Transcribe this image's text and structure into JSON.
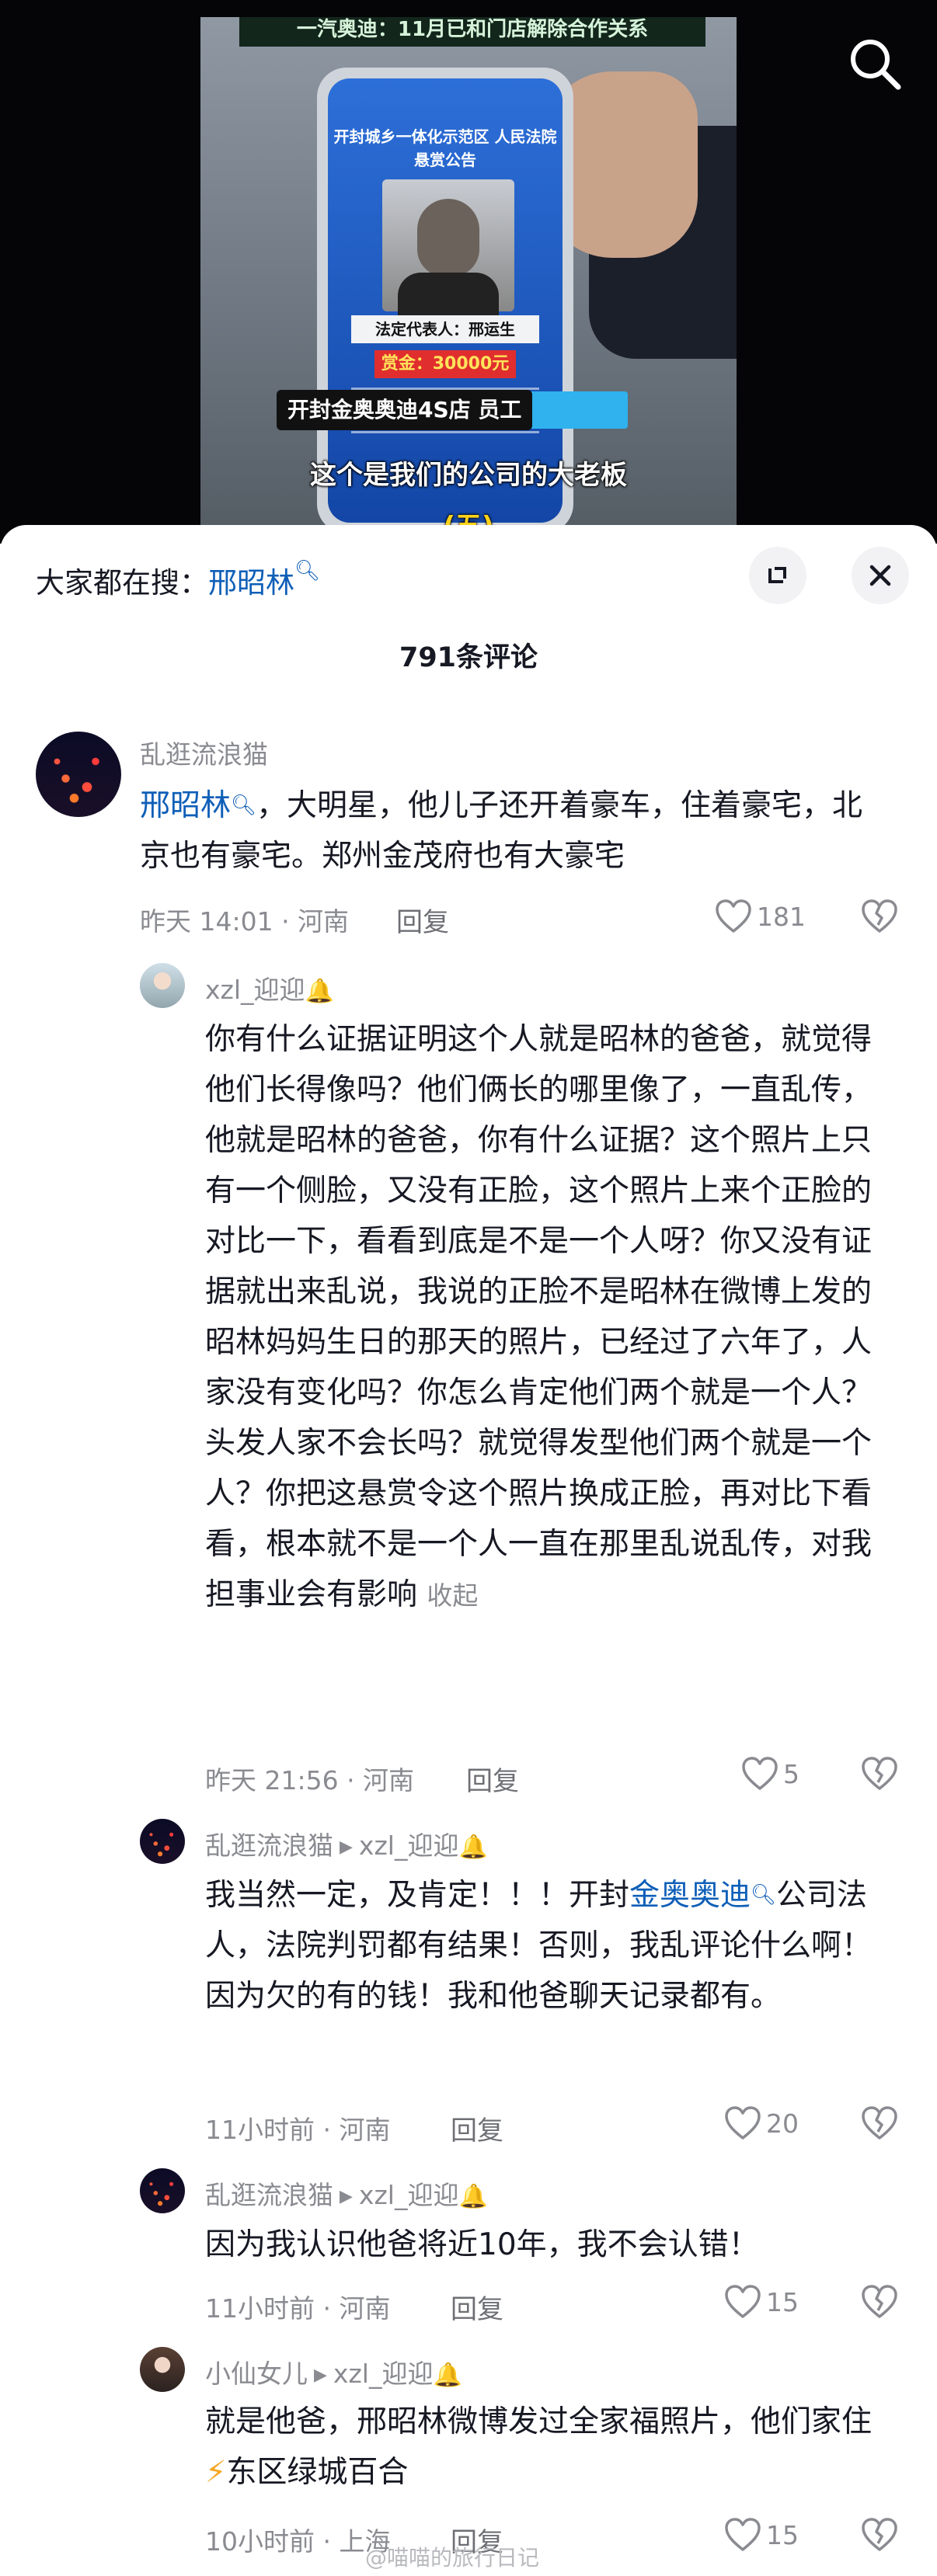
{
  "video": {
    "banner": "一汽奥迪：11月已和门店解除合作关系",
    "notice_title": "开封城乡一体化示范区 人民法院悬赏公告",
    "representative": "法定代表人：邢运生",
    "reward": "赏金：30000元",
    "caption_name": "开封金奥奥迪4S店 员工",
    "caption_line": "这个是我们的公司的大老板",
    "caption_tag": "(五)"
  },
  "search_bar": {
    "prefix": "大家都在搜：",
    "term": "邢昭林"
  },
  "comment_count": "791条评论",
  "comments": [
    {
      "user": "乱逛流浪猫",
      "link": "邢昭林",
      "text": "，大明星，他儿子还开着豪车，住着豪宅，北京也有豪宅。郑州金茂府也有大豪宅",
      "meta": "昨天 14:01 · 河南",
      "reply": "回复",
      "likes": "181"
    },
    {
      "user": "xzl_迎迎",
      "text": "你有什么证据证明这个人就是昭林的爸爸，就觉得他们长得像吗？他们俩长的哪里像了，一直乱传，他就是昭林的爸爸，你有什么证据？这个照片上只有一个侧脸，又没有正脸，这个照片上来个正脸的对比一下，看看到底是不是一个人呀？你又没有证据就出来乱说，我说的正脸不是昭林在微博上发的昭林妈妈生日的那天的照片，已经过了六年了，人家没有变化吗？你怎么肯定他们两个就是一个人？头发人家不会长吗？就觉得发型他们两个就是一个人？你把这悬赏令这个照片换成正脸，再对比下看看，根本就不是一个人一直在那里乱说乱传，对我担事业会有影响",
      "fold": "收起",
      "meta": "昨天 21:56 · 河南",
      "reply": "回复",
      "likes": "5"
    },
    {
      "user": "乱逛流浪猫",
      "reply_to": "xzl_迎迎",
      "text_before": "我当然一定，及肯定！！！开封",
      "link": "金奥奥迪",
      "text_after": "公司法人，法院判罚都有结果！否则，我乱评论什么啊！因为欠的有的钱！我和他爸聊天记录都有。",
      "meta": "11小时前 · 河南",
      "reply": "回复",
      "likes": "20"
    },
    {
      "user": "乱逛流浪猫",
      "reply_to": "xzl_迎迎",
      "text": "因为我认识他爸将近10年，我不会认错！",
      "meta": "11小时前 · 河南",
      "reply": "回复",
      "likes": "15"
    },
    {
      "user": "小仙女儿",
      "reply_to": "xzl_迎迎",
      "text_before": "就是他爸，邢昭林微博发过全家福照片，他们家住",
      "text_after": "东区绿城百合",
      "meta": "10小时前 · 上海",
      "reply": "回复",
      "likes": "15"
    }
  ],
  "watermark": "@喵喵的旅行日记",
  "colors": {
    "link": "#0f5fb8",
    "muted": "#8a8b91",
    "text": "#161823"
  },
  "icons": [
    "search-icon",
    "magnifier-icon",
    "collapse-icon",
    "close-icon",
    "heart-icon",
    "broken-heart-icon",
    "bell-icon",
    "play-arrow-icon",
    "lightning-icon"
  ]
}
